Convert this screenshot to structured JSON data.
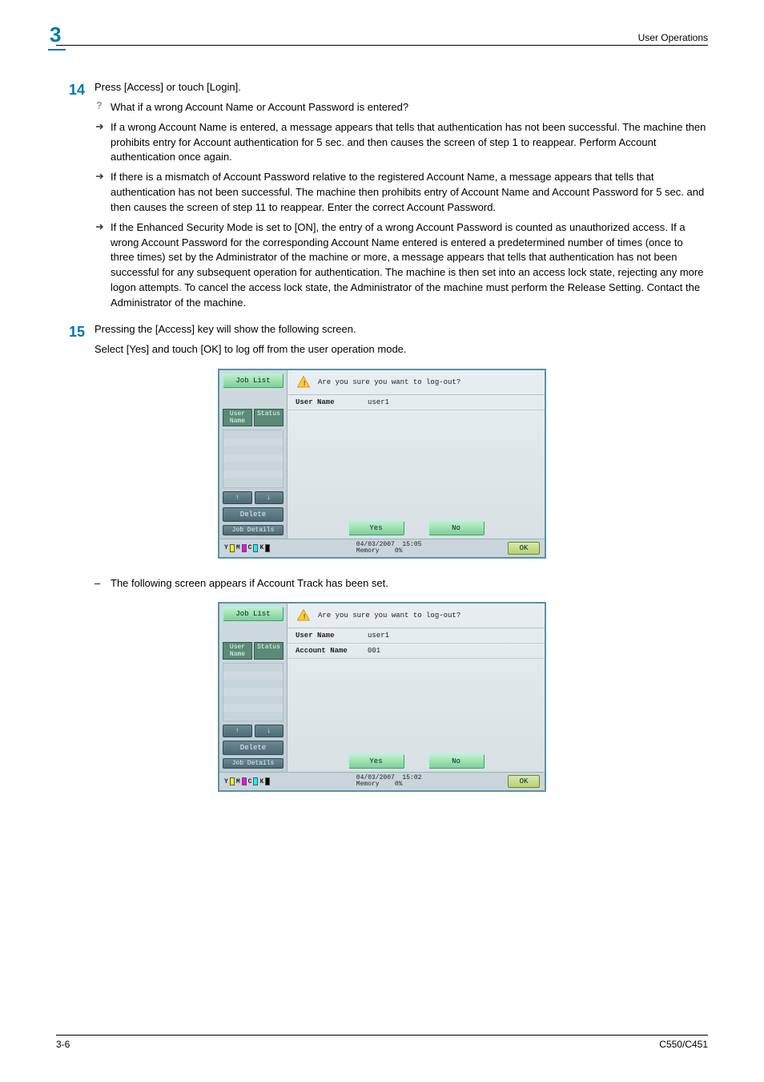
{
  "header": {
    "chapter": "3",
    "section": "User Operations"
  },
  "steps": {
    "s14": {
      "num": "14",
      "intro": "Press [Access] or touch [Login].",
      "q": "What if a wrong Account Name or Account Password is entered?",
      "b1": "If a wrong Account Name is entered, a message appears that tells that authentication has not been successful. The machine then prohibits entry for Account authentication for 5 sec. and then causes the screen of step 1 to reappear. Perform Account authentication once again.",
      "b2": "If there is a mismatch of Account Password relative to the registered Account Name, a message appears that tells that authentication has not been successful. The machine then prohibits entry of Account Name and Account Password for 5 sec. and then causes the screen of step 11 to reappear. Enter the correct Account Password.",
      "b3": "If the Enhanced Security Mode is set to [ON], the entry of a wrong Account Password is counted as unauthorized access. If a wrong Account Password for the corresponding Account Name entered is entered a predetermined number of times (once to three times) set by the Administrator of the machine or more, a message appears that tells that authentication has not been successful for any subsequent operation for authentication. The machine is then set into an access lock state, rejecting any more logon attempts. To cancel the access lock state, the Administrator of the machine must perform the Release Setting. Contact the Administrator of the machine."
    },
    "s15": {
      "num": "15",
      "l1": "Pressing the [Access] key will show the following screen.",
      "l2": "Select [Yes] and touch [OK] to log off from the user operation mode.",
      "note": "The following screen appears if Account Track has been set."
    }
  },
  "screen1": {
    "jobList": "Job List",
    "userTab": "User Name",
    "statusTab": "Status",
    "delete": "Delete",
    "jobDetails": "Job Details",
    "upArrow": "↑",
    "downArrow": "↓",
    "prompt": "Are you sure you want to log-out?",
    "userNameLabel": "User Name",
    "userNameValue": "user1",
    "yes": "Yes",
    "no": "No",
    "date": "04/03/2007",
    "time": "15:05",
    "memLabel": "Memory",
    "memValue": "0%",
    "ok": "OK",
    "tonerY": "Y",
    "tonerM": "M",
    "tonerC": "C",
    "tonerK": "K"
  },
  "screen2": {
    "jobList": "Job List",
    "userTab": "User Name",
    "statusTab": "Status",
    "delete": "Delete",
    "jobDetails": "Job Details",
    "upArrow": "↑",
    "downArrow": "↓",
    "prompt": "Are you sure you want to log-out?",
    "userNameLabel": "User Name",
    "userNameValue": "user1",
    "accountNameLabel": "Account Name",
    "accountNameValue": "001",
    "yes": "Yes",
    "no": "No",
    "date": "04/03/2007",
    "time": "15:02",
    "memLabel": "Memory",
    "memValue": "0%",
    "ok": "OK",
    "tonerY": "Y",
    "tonerM": "M",
    "tonerC": "C",
    "tonerK": "K"
  },
  "footer": {
    "pageNum": "3-6",
    "model": "C550/C451"
  }
}
